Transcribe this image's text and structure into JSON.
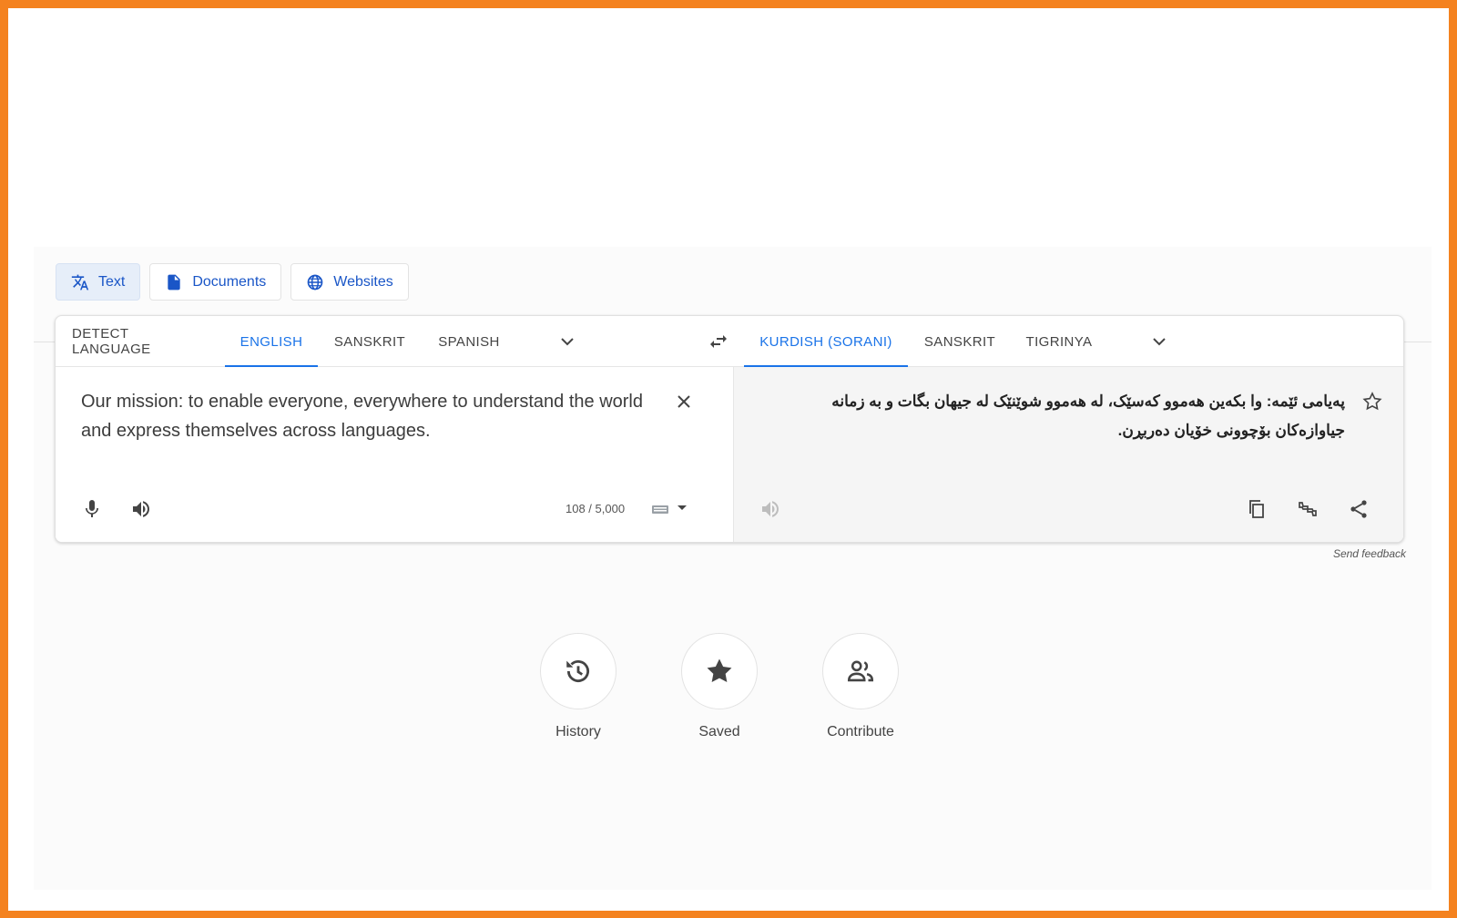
{
  "mode_tabs": [
    {
      "label": "Text",
      "icon": "translate-icon",
      "active": true
    },
    {
      "label": "Documents",
      "icon": "document-icon",
      "active": false
    },
    {
      "label": "Websites",
      "icon": "globe-icon",
      "active": false
    }
  ],
  "source_languages": [
    "DETECT LANGUAGE",
    "ENGLISH",
    "SANSKRIT",
    "SPANISH"
  ],
  "source_selected": "ENGLISH",
  "target_languages": [
    "KURDISH (SORANI)",
    "SANSKRIT",
    "TIGRINYA"
  ],
  "target_selected": "KURDISH (SORANI)",
  "source_text": "Our mission: to enable everyone, everywhere to understand the world and express themselves across languages.",
  "translated_text": "پەیامی ئێمە: وا بکەین هەموو کەسێک، لە هەموو شوێنێک لە جیهان بگات و بە زمانە جیاوازەکان بۆچوونی خۆیان دەربڕن.",
  "char_count": "108 / 5,000",
  "send_feedback": "Send feedback",
  "bottom_actions": [
    {
      "label": "History",
      "icon": "history-icon"
    },
    {
      "label": "Saved",
      "icon": "star-icon"
    },
    {
      "label": "Contribute",
      "icon": "people-icon"
    }
  ],
  "colors": {
    "accent": "#1a73e8",
    "frame": "#f4821f"
  }
}
